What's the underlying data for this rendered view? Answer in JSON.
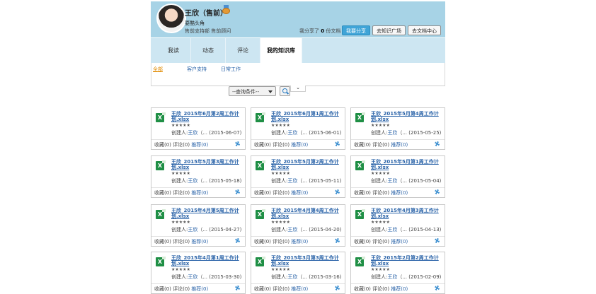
{
  "profile": {
    "name": "王欣（售前）",
    "signature": "耍酷头角",
    "department": "售前支持部 售前顾问",
    "share_prefix": "我分享了",
    "share_count": "0",
    "share_suffix": "份文档",
    "buttons": [
      "我要分享",
      "去知识广场",
      "去文档中心"
    ]
  },
  "tabs": [
    "我读",
    "动态",
    "评论",
    "我的知识库"
  ],
  "subnav": [
    "全部",
    "客户支持",
    "日常工作"
  ],
  "query": {
    "label": "--查询条件--"
  },
  "cards": [
    {
      "title": "王欣_2015年6月第2周工作计划.xlsx",
      "stars": "★★★★★",
      "creator": "创建人:",
      "who": "王欣",
      "date": "（... (2015-06-07)",
      "fav": "收藏(0)",
      "comment": "评论(0)",
      "rec": "推荐(0)"
    },
    {
      "title": "王欣_2015年6月第1周工作计划.xlsx",
      "stars": "★★★★★",
      "creator": "创建人:",
      "who": "王欣",
      "date": "（... (2015-06-01)",
      "fav": "收藏(0)",
      "comment": "评论(0)",
      "rec": "推荐(0)"
    },
    {
      "title": "王欣_2015年5月第4周工作计划.xlsx",
      "stars": "★★★★★",
      "creator": "创建人:",
      "who": "王欣",
      "date": "（... (2015-05-25)",
      "fav": "收藏(0)",
      "comment": "评论(0)",
      "rec": "推荐(0)"
    },
    {
      "title": "王欣_2015年5月第3周工作计划.xlsx",
      "stars": "★★★★★",
      "creator": "创建人:",
      "who": "王欣",
      "date": "（... (2015-05-18)",
      "fav": "收藏(0)",
      "comment": "评论(0)",
      "rec": "推荐(0)"
    },
    {
      "title": "王欣_2015年5月第2周工作计划.xlsx",
      "stars": "★★★★★",
      "creator": "创建人:",
      "who": "王欣",
      "date": "（... (2015-05-11)",
      "fav": "收藏(0)",
      "comment": "评论(0)",
      "rec": "推荐(0)"
    },
    {
      "title": "王欣_2015年5月第1周工作计划.xlsx",
      "stars": "★★★★★",
      "creator": "创建人:",
      "who": "王欣",
      "date": "（... (2015-05-04)",
      "fav": "收藏(0)",
      "comment": "评论(0)",
      "rec": "推荐(0)"
    },
    {
      "title": "王欣_2015年4月第5周工作计划.xlsx",
      "stars": "★★★★★",
      "creator": "创建人:",
      "who": "王欣",
      "date": "（... (2015-04-27)",
      "fav": "收藏(0)",
      "comment": "评论(0)",
      "rec": "推荐(0)"
    },
    {
      "title": "王欣_2015年4月第4周工作计划.xlsx",
      "stars": "★★★★★",
      "creator": "创建人:",
      "who": "王欣",
      "date": "（... (2015-04-20)",
      "fav": "收藏(0)",
      "comment": "评论(0)",
      "rec": "推荐(0)"
    },
    {
      "title": "王欣_2015年4月第3周工作计划.xlsx",
      "stars": "★★★★★",
      "creator": "创建人:",
      "who": "王欣",
      "date": "（... (2015-04-13)",
      "fav": "收藏(0)",
      "comment": "评论(0)",
      "rec": "推荐(0)"
    },
    {
      "title": "王欣_2015年4月第1周工作计划.xlsx",
      "stars": "★★★★★",
      "creator": "创建人:",
      "who": "王欣",
      "date": "（... (2015-03-30)",
      "fav": "收藏(0)",
      "comment": "评论(0)",
      "rec": "推荐(0)"
    },
    {
      "title": "王欣_2015年3月第3周工作计划.xlsx",
      "stars": "★★★★★",
      "creator": "创建人:",
      "who": "王欣",
      "date": "（... (2015-03-16)",
      "fav": "收藏(0)",
      "comment": "评论(0)",
      "rec": "推荐(0)"
    },
    {
      "title": "王欣_2015年2月第2周工作计划.xlsx",
      "stars": "★★★★★",
      "creator": "创建人:",
      "who": "王欣",
      "date": "（... (2015-02-09)",
      "fav": "收藏(0)",
      "comment": "评论(0)",
      "rec": "推荐(0)"
    }
  ]
}
